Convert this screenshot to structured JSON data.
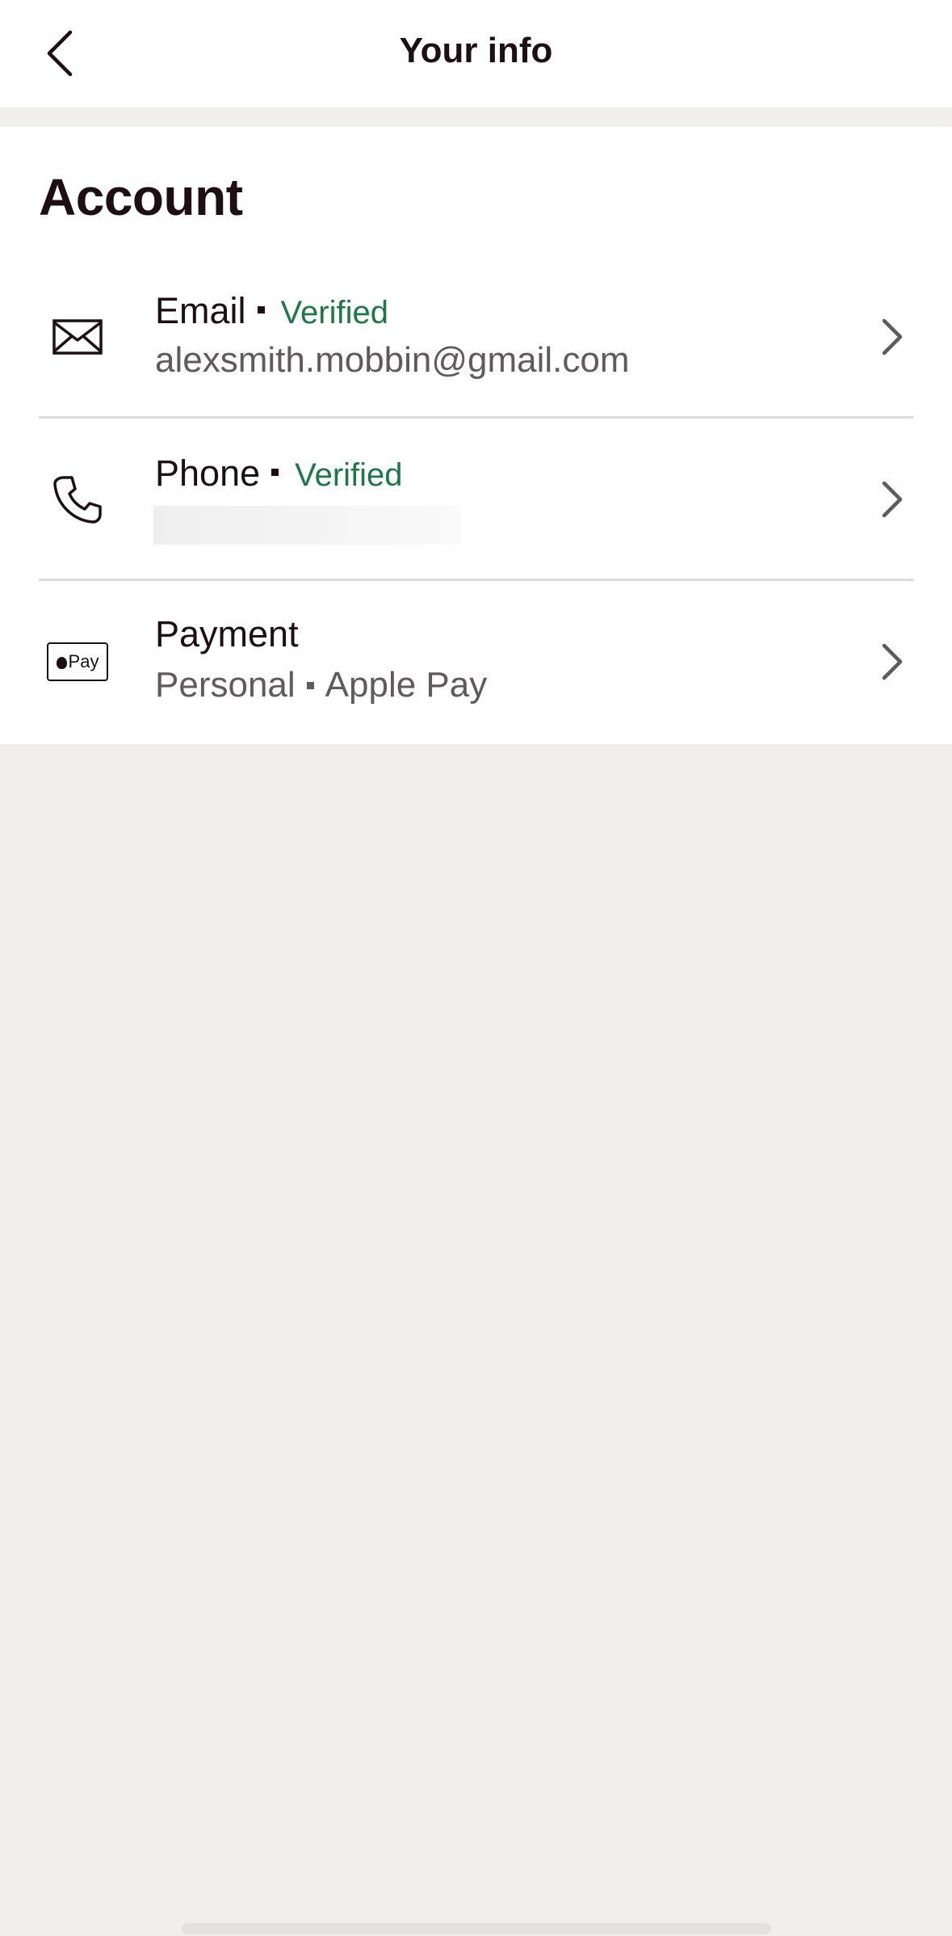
{
  "header": {
    "title": "Your info",
    "back_icon": "chevron-left-icon"
  },
  "account": {
    "section_title": "Account",
    "rows": [
      {
        "label": "Email",
        "status": "Verified",
        "value": "alexsmith.mobbin@gmail.com",
        "icon": "envelope-icon"
      },
      {
        "label": "Phone",
        "status": "Verified",
        "value": "",
        "icon": "phone-icon"
      },
      {
        "label": "Payment",
        "value_primary": "Personal",
        "value_secondary": "Apple Pay",
        "icon": "apple-pay-icon",
        "icon_text": "Pay"
      }
    ]
  },
  "colors": {
    "text": "#1e0f14",
    "verified": "#1a7a46",
    "secondary_text": "#5f5a5c",
    "background": "#f0efeb"
  }
}
